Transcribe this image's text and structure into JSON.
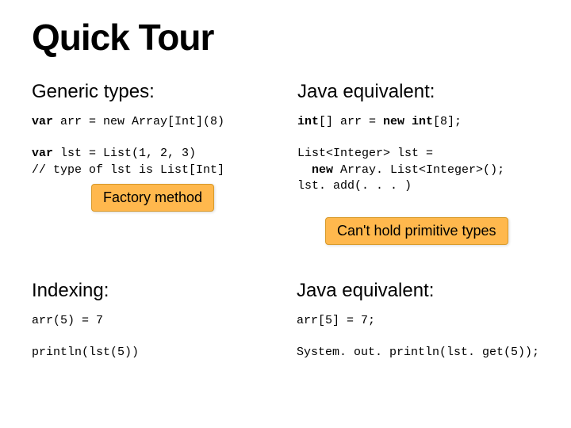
{
  "title": "Quick Tour",
  "left": {
    "heading1": "Generic types:",
    "heading2": "Indexing:",
    "code1_kw": "var",
    "code1_rest": " arr = new Array[Int](8)",
    "code2_kw": "var",
    "code2_rest": " lst = List(1, 2, 3)\n// type of lst is List[Int]",
    "code3": "arr(5) = 7",
    "code4": "println(lst(5))"
  },
  "right": {
    "heading1": "Java equivalent:",
    "heading2": "Java equivalent:",
    "code1_a": "int",
    "code1_b": "[] arr = ",
    "code1_c": "new int",
    "code1_d": "[8];",
    "code2_a": "List<Integer> lst =\n  ",
    "code2_b": "new",
    "code2_c": " Array. List<Integer>();\nlst. add(. . . )",
    "code3": "arr[5] = 7;",
    "code4": "System. out. println(lst. get(5));"
  },
  "callouts": {
    "factory": "Factory method",
    "primitive": "Can't hold primitive types"
  }
}
